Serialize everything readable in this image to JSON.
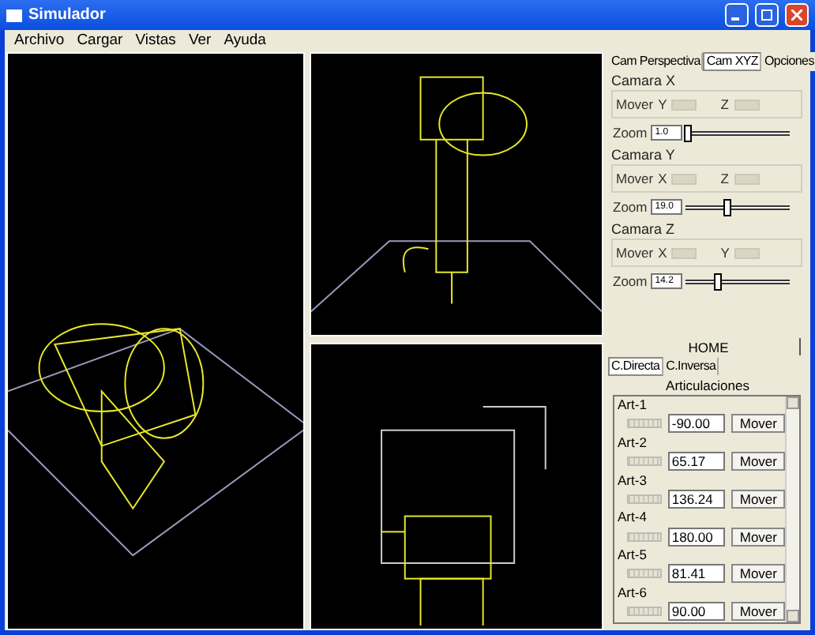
{
  "window": {
    "title": "Simulador"
  },
  "menu": [
    "Archivo",
    "Cargar",
    "Vistas",
    "Ver",
    "Ayuda"
  ],
  "camera_tabs": [
    {
      "label": "Cam Perspectiva",
      "selected": false
    },
    {
      "label": "Cam XYZ",
      "selected": true
    },
    {
      "label": "Opciones",
      "selected": false
    }
  ],
  "cameras": [
    {
      "title": "Camara X",
      "move_label": "Mover",
      "axes": [
        {
          "label": "Y",
          "level": 1
        },
        {
          "label": "Z",
          "level": 1
        }
      ],
      "zoom_label": "Zoom",
      "zoom": "1.0",
      "level": 0.02
    },
    {
      "title": "Camara Y",
      "move_label": "Mover",
      "axes": [
        {
          "label": "X",
          "level": 1
        },
        {
          "label": "Z",
          "level": 1
        }
      ],
      "zoom_label": "Zoom",
      "zoom": "19.0",
      "level": 0.4
    },
    {
      "title": "Camara Z",
      "move_label": "Mover",
      "axes": [
        {
          "label": "X",
          "level": 1
        },
        {
          "label": "Y",
          "level": 1
        }
      ],
      "zoom_label": "Zoom",
      "zoom": "14.2",
      "level": 0.3
    }
  ],
  "home_button": "HOME",
  "kinematics_tabs": [
    {
      "label": "C.Directa",
      "selected": true
    },
    {
      "label": "C.Inversa",
      "selected": false
    }
  ],
  "joints_title": "Articulaciones",
  "joints": [
    {
      "name": "Art-1",
      "value": "-90.00",
      "button": "Mover",
      "level": 1
    },
    {
      "name": "Art-2",
      "value": "65.17",
      "button": "Mover",
      "level": 1
    },
    {
      "name": "Art-3",
      "value": "136.24",
      "button": "Mover",
      "level": 1
    },
    {
      "name": "Art-4",
      "value": "180.00",
      "button": "Mover",
      "level": 1
    },
    {
      "name": "Art-5",
      "value": "81.41",
      "button": "Mover",
      "level": 1
    },
    {
      "name": "Art-6",
      "value": "90.00",
      "button": "Mover",
      "level": 1
    }
  ]
}
